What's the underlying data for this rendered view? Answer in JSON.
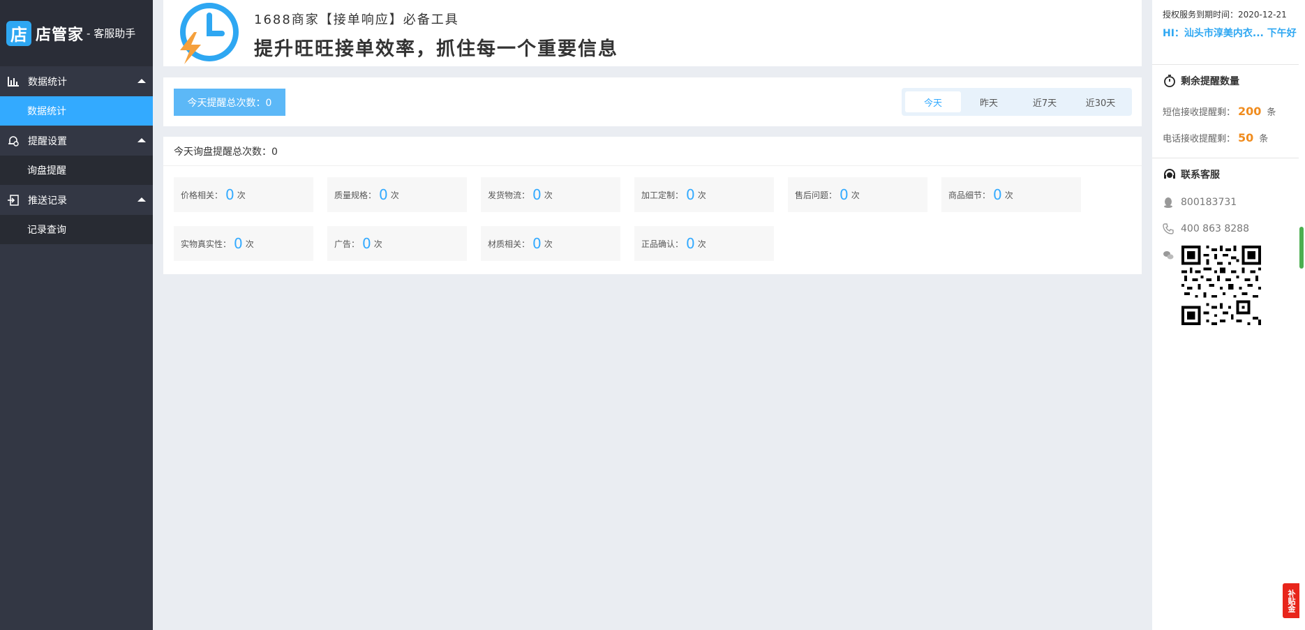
{
  "sidebar": {
    "logo_badge": "店",
    "logo_name": "店管家",
    "logo_sub": "- 客服助手",
    "groups": [
      {
        "icon": "bar-chart-icon",
        "label": "数据统计",
        "items": [
          {
            "label": "数据统计",
            "active": true
          }
        ]
      },
      {
        "icon": "bell-gear-icon",
        "label": "提醒设置",
        "items": [
          {
            "label": "询盘提醒",
            "active": false
          }
        ]
      },
      {
        "icon": "push-record-icon",
        "label": "推送记录",
        "items": [
          {
            "label": "记录查询",
            "active": false
          }
        ]
      }
    ]
  },
  "banner": {
    "line1": "1688商家【接单响应】必备工具",
    "line2": "提升旺旺接单效率，抓住每一个重要信息",
    "icon": "clock-lightning-icon"
  },
  "stats": {
    "total_label": "今天提醒总次数：0",
    "tabs": [
      "今天",
      "昨天",
      "近7天",
      "近30天"
    ],
    "active_tab": 0
  },
  "detail": {
    "title": "今天询盘提醒总次数：0",
    "unit": "次",
    "cards": [
      {
        "label": "价格相关：",
        "value": "0"
      },
      {
        "label": "质量规格：",
        "value": "0"
      },
      {
        "label": "发货物流：",
        "value": "0"
      },
      {
        "label": "加工定制：",
        "value": "0"
      },
      {
        "label": "售后问题：",
        "value": "0"
      },
      {
        "label": "商品细节：",
        "value": "0"
      },
      {
        "label": "实物真实性：",
        "value": "0"
      },
      {
        "label": "广告：",
        "value": "0"
      },
      {
        "label": "材质相关：",
        "value": "0"
      },
      {
        "label": "正品确认：",
        "value": "0"
      }
    ]
  },
  "rpanel": {
    "expire": "授权服务到期时间：2020-12-21",
    "hi": "HI：汕头市淳美内衣... 下午好",
    "remain_title": "剩余提醒数量",
    "sms_label": "短信接收提醒剩：",
    "sms_value": "200",
    "phone_label": "电话接收提醒剩：",
    "phone_value": "50",
    "unit": "条",
    "contact_title": "联系客服",
    "qq": "800183731",
    "phone": "400 863 8288"
  },
  "float_badge": "补贴金",
  "colors": {
    "accent": "#33aaff",
    "sidebar": "#333744",
    "orange": "#f08c1e"
  }
}
